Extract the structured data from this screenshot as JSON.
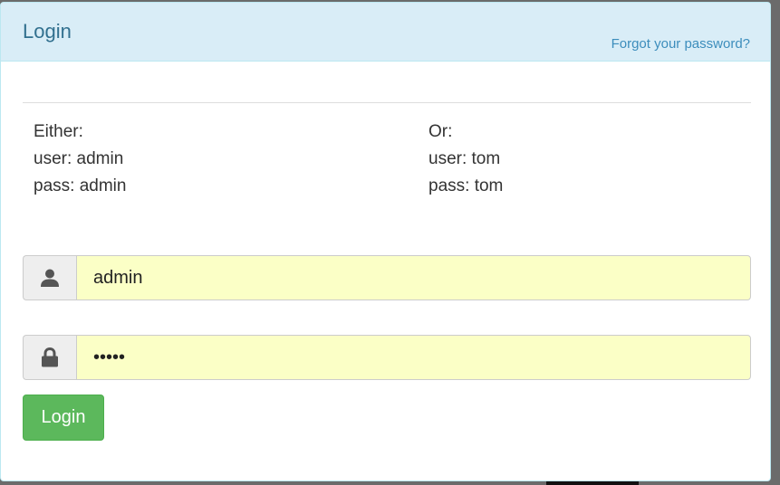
{
  "panel": {
    "title": "Login",
    "forgot_link": "Forgot your password?"
  },
  "credentials": {
    "left": {
      "heading": "Either:",
      "user": "user: admin",
      "pass": "pass: admin"
    },
    "right": {
      "heading": "Or:",
      "user": "user: tom",
      "pass": "pass: tom"
    }
  },
  "form": {
    "username_value": "admin",
    "username_icon": "user-icon",
    "password_value": "admin",
    "password_icon": "lock-icon",
    "login_label": "Login"
  },
  "colors": {
    "heading_bg": "#d9edf7",
    "title_text": "#31708f",
    "link": "#3c8dbc",
    "autofill_bg": "#fbffc6",
    "button_success": "#5cb85c"
  }
}
